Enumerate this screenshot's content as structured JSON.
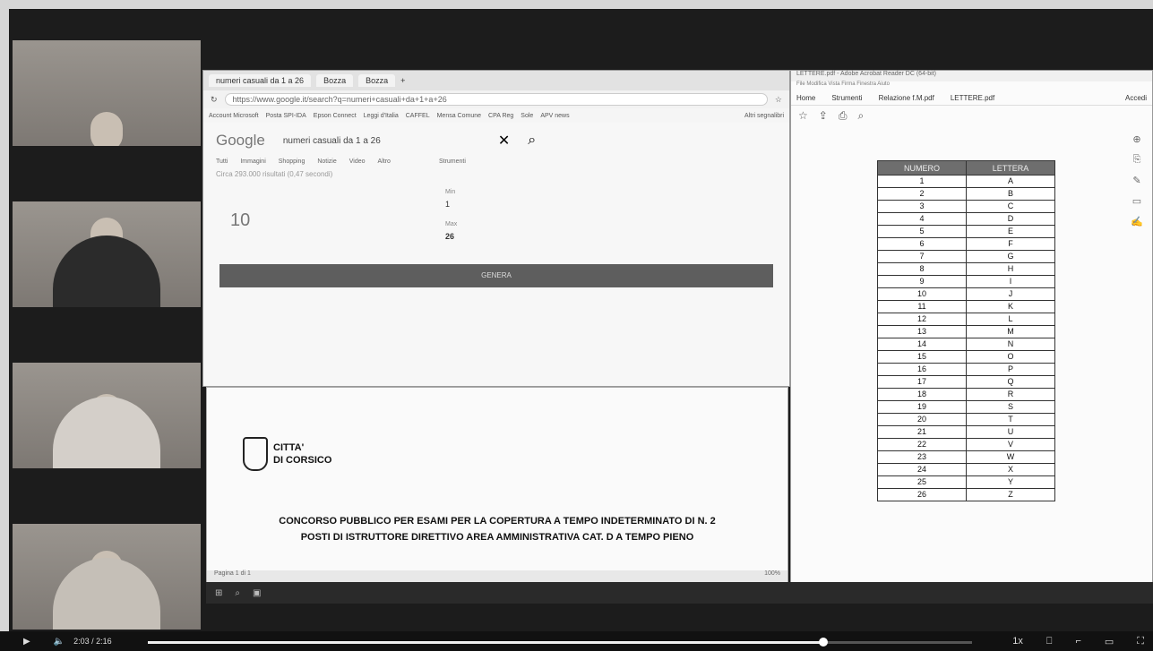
{
  "browser": {
    "tabs": [
      "numeri casuali da 1 a 26",
      "Bozza",
      "Bozza"
    ],
    "url": "https://www.google.it/search?q=numeri+casuali+da+1+a+26",
    "bookmarks": [
      "Account Microsoft",
      "Posta SPI-IDA",
      "Epson Connect",
      "Leggi d'Italia",
      "CAFFEL",
      "Mensa Comune",
      "CPA Reg",
      "Sole",
      "APV news",
      "Altri segnalibri"
    ]
  },
  "google": {
    "logo": "Google",
    "query": "numeri casuali da 1 a 26",
    "tabs": [
      "Tutti",
      "Immagini",
      "Shopping",
      "Notizie",
      "Video",
      "Altro",
      "Strumenti"
    ],
    "results_count": "Circa 293.000 risultati (0,47 secondi)",
    "rng": {
      "result": "10",
      "min_label": "Min",
      "min_value": "1",
      "max_label": "Max",
      "max_value": "26",
      "button": "GENERA"
    }
  },
  "doc": {
    "logo_line1": "CITTA'",
    "logo_line2": "DI CORSICO",
    "title_line1": "CONCORSO PUBBLICO PER ESAMI PER LA COPERTURA A TEMPO INDETERMINATO DI N. 2",
    "title_line2": "POSTI DI ISTRUTTORE DIRETTIVO AREA AMMINISTRATIVA CAT. D A TEMPO PIENO",
    "status_left": "Pagina 1 di 1",
    "status_right": "100%"
  },
  "pdf": {
    "title": "LETTERE.pdf - Adobe Acrobat Reader DC (64-bit)",
    "menu": "File  Modifica  Vista  Firma  Finestra  Aiuto",
    "toolbar": [
      "Home",
      "Strumenti",
      "Relazione f.M.pdf",
      "LETTERE.pdf",
      "Accedi"
    ],
    "table": {
      "headers": [
        "NUMERO",
        "LETTERA"
      ],
      "rows": [
        [
          "1",
          "A"
        ],
        [
          "2",
          "B"
        ],
        [
          "3",
          "C"
        ],
        [
          "4",
          "D"
        ],
        [
          "5",
          "E"
        ],
        [
          "6",
          "F"
        ],
        [
          "7",
          "G"
        ],
        [
          "8",
          "H"
        ],
        [
          "9",
          "I"
        ],
        [
          "10",
          "J"
        ],
        [
          "11",
          "K"
        ],
        [
          "12",
          "L"
        ],
        [
          "13",
          "M"
        ],
        [
          "14",
          "N"
        ],
        [
          "15",
          "O"
        ],
        [
          "16",
          "P"
        ],
        [
          "17",
          "Q"
        ],
        [
          "18",
          "R"
        ],
        [
          "19",
          "S"
        ],
        [
          "20",
          "T"
        ],
        [
          "21",
          "U"
        ],
        [
          "22",
          "V"
        ],
        [
          "23",
          "W"
        ],
        [
          "24",
          "X"
        ],
        [
          "25",
          "Y"
        ],
        [
          "26",
          "Z"
        ]
      ]
    }
  },
  "player": {
    "time": "2:03 / 2:16",
    "speed": "1x",
    "progress_pct": 82
  }
}
